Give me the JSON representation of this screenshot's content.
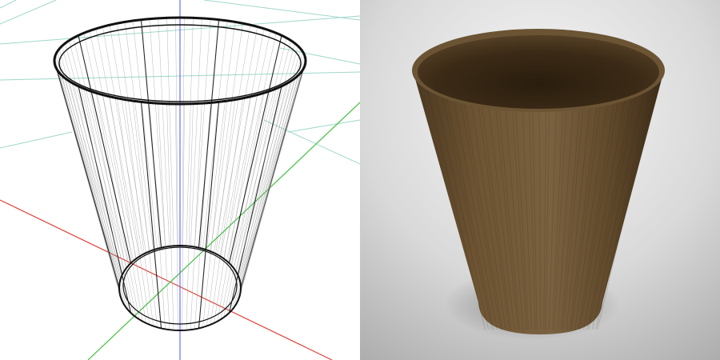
{
  "panels": [
    {
      "name": "wireframe-view",
      "background": "#ffffff"
    },
    {
      "name": "rendered-view",
      "background": "#bdbdbd"
    }
  ],
  "colors": {
    "grid": "#9fd7cc",
    "axis_x": "#e0423a",
    "axis_y": "#3fbf3f",
    "axis_z": "#6b6bff",
    "wire": "#111111",
    "wire_light": "#8a8a8a",
    "wood_dark": "#3a2a18",
    "wood_mid": "#6a5232",
    "wood_light": "#7e6640",
    "floor_light": "#f4f4f4",
    "floor_dark": "#a9a9a9"
  },
  "object": {
    "kind": "tapered-cup",
    "material": "wood",
    "icons": [
      "wireframe-icon",
      "shaded-render-icon"
    ]
  }
}
